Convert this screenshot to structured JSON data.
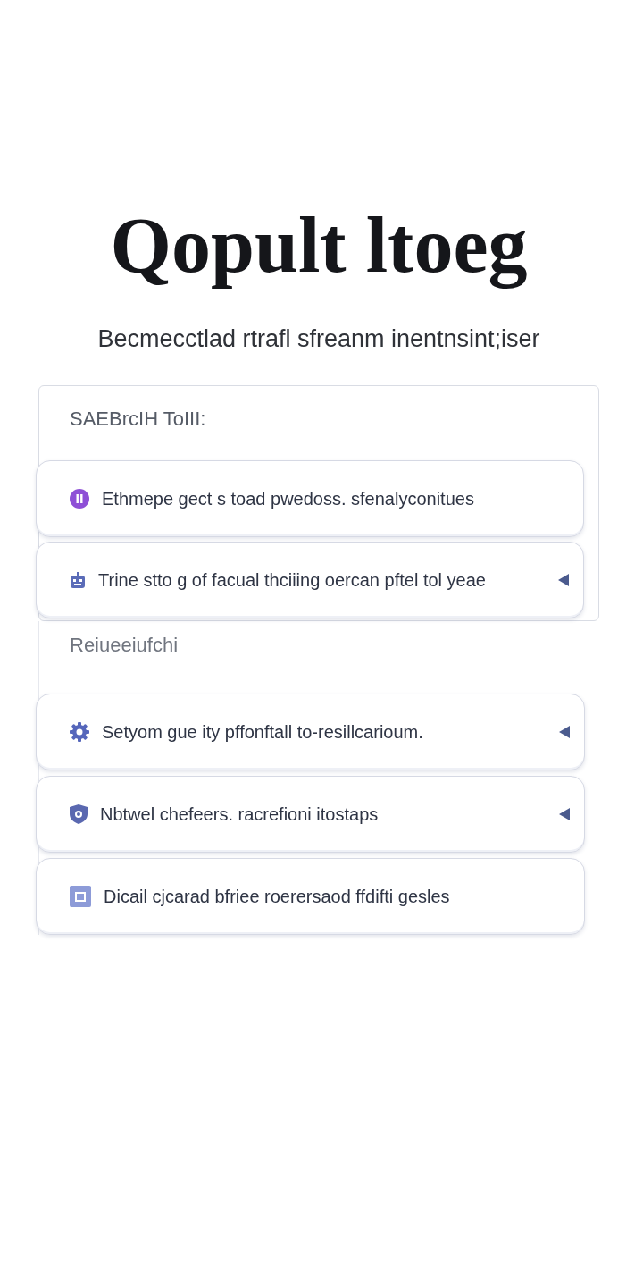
{
  "title": "Qopult ltoeg",
  "subtitle": "Becmecctlad rtrafl sfreanm inentnsint;iser",
  "sections": [
    {
      "kind": "panel",
      "heading": "SAEBrcIH ToIII:",
      "items": [
        {
          "text": "Ethmepe gect s toad pwedoss. sfenalyconitues",
          "color": "#8e4fd6",
          "arrow": false
        },
        {
          "text": "Trine stto g of facual thciiing oercan pftel tol yeae",
          "color": "#5b6cb8",
          "arrow": true
        }
      ]
    },
    {
      "kind": "plain",
      "heading": "Reiueeiufchi",
      "items": [
        {
          "text": "Setyom gue ity pffonftall to-resillcarioum.",
          "color": "#5566bb",
          "arrow": true
        },
        {
          "text": "Nbtwel chefeers. racrefioni itostaps",
          "color": "#5a68b0",
          "arrow": true
        },
        {
          "text": "Dicail cjcarad bfriee roerersaod ffdifti gesles",
          "color": "#8d9bd8",
          "arrow": false
        }
      ]
    }
  ]
}
